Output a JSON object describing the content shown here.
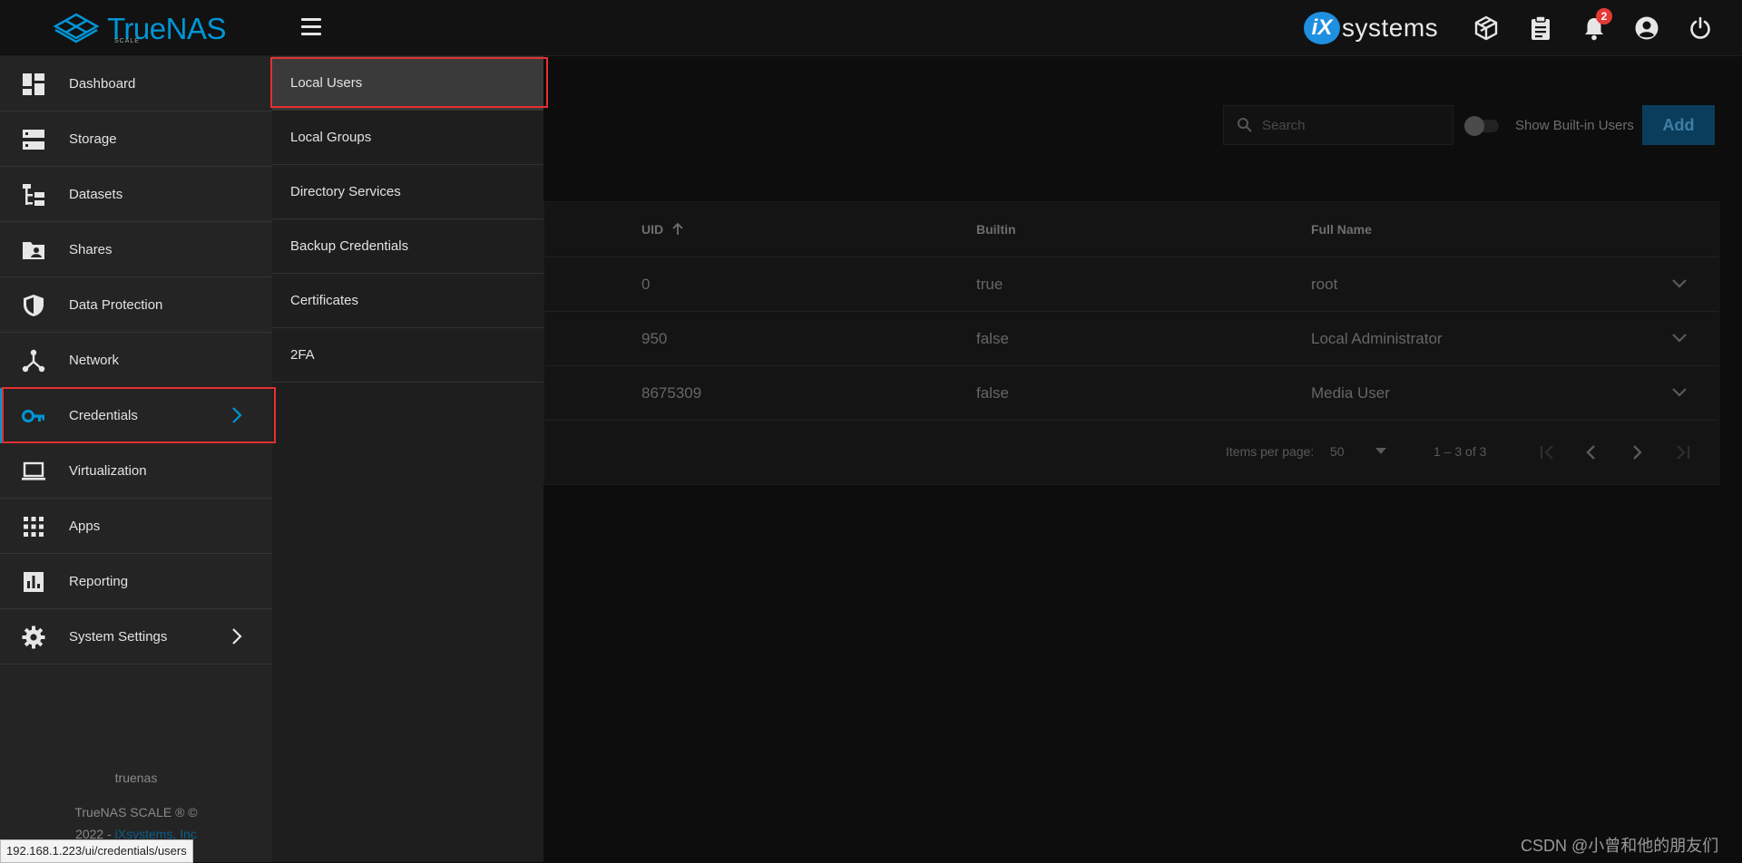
{
  "brand": {
    "logo_text": "TrueNAS",
    "logo_sub": "SCALE",
    "vendor_text": "systems",
    "vendor_badge": "iX"
  },
  "topbar": {
    "notifications_count": "2"
  },
  "sidebar": {
    "items": [
      {
        "label": "Dashboard",
        "icon": "dashboard-icon"
      },
      {
        "label": "Storage",
        "icon": "storage-icon"
      },
      {
        "label": "Datasets",
        "icon": "datasets-icon"
      },
      {
        "label": "Shares",
        "icon": "shares-icon"
      },
      {
        "label": "Data Protection",
        "icon": "shield-icon"
      },
      {
        "label": "Network",
        "icon": "network-icon"
      },
      {
        "label": "Credentials",
        "icon": "key-icon"
      },
      {
        "label": "Virtualization",
        "icon": "laptop-icon"
      },
      {
        "label": "Apps",
        "icon": "apps-grid-icon"
      },
      {
        "label": "Reporting",
        "icon": "bar-chart-icon"
      },
      {
        "label": "System Settings",
        "icon": "gear-icon"
      }
    ],
    "hostname": "truenas",
    "copyright_line1": "TrueNAS SCALE ® ©",
    "copyright_line2": "2022 -",
    "copyright_link": "iXsystems, Inc"
  },
  "submenu": {
    "items": [
      "Local Users",
      "Local Groups",
      "Directory Services",
      "Backup Credentials",
      "Certificates",
      "2FA"
    ]
  },
  "toolbar": {
    "search_placeholder": "Search",
    "toggle_label": "Show Built-in Users",
    "add_label": "Add"
  },
  "table": {
    "columns": [
      "UID",
      "Builtin",
      "Full Name"
    ],
    "rows": [
      {
        "uid": "0",
        "builtin": "true",
        "full_name": "root"
      },
      {
        "uid": "950",
        "builtin": "false",
        "full_name": "Local Administrator"
      },
      {
        "uid": "8675309",
        "builtin": "false",
        "full_name": "Media User"
      }
    ],
    "items_per_page_label": "Items per page:",
    "items_per_page_value": "50",
    "range_label": "1 – 3 of 3"
  },
  "status_url": "192.168.1.223/ui/credentials/users",
  "watermark": "CSDN @小曾和他的朋友们",
  "colors": {
    "accent": "#0095d5",
    "highlight_box": "#e53030",
    "badge": "#e53935"
  }
}
